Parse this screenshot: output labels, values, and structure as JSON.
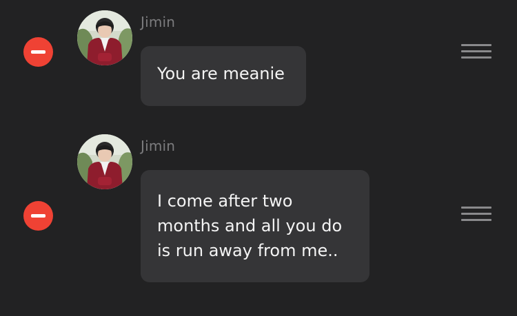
{
  "messages": [
    {
      "sender": "Jimin",
      "lines": [
        "You are meanie"
      ]
    },
    {
      "sender": "Jimin",
      "lines": [
        "I come after two",
        "months and all you do",
        "is run away from me.."
      ]
    }
  ],
  "colors": {
    "background": "#222223",
    "bubble": "#353537",
    "delete": "#ef4234",
    "sender": "#7c7c7e",
    "text": "#f4f4f4"
  },
  "icons": {
    "delete": "minus-circle-icon",
    "reorder": "drag-handle-icon"
  }
}
